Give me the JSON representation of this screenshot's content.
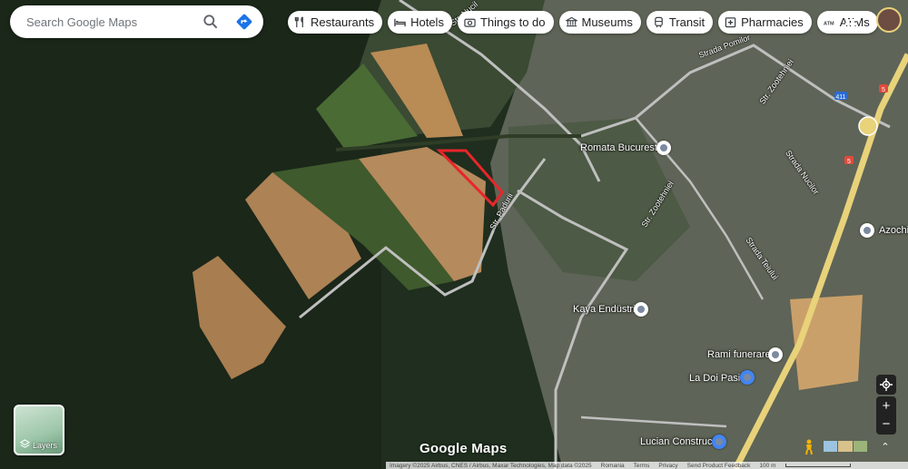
{
  "search": {
    "placeholder": "Search Google Maps"
  },
  "chips": [
    {
      "label": "Restaurants",
      "icon": "fork-knife-icon"
    },
    {
      "label": "Hotels",
      "icon": "bed-icon"
    },
    {
      "label": "Things to do",
      "icon": "camera-icon"
    },
    {
      "label": "Museums",
      "icon": "museum-icon"
    },
    {
      "label": "Transit",
      "icon": "train-icon"
    },
    {
      "label": "Pharmacies",
      "icon": "pharmacy-icon"
    },
    {
      "label": "ATMs",
      "icon": "atm-icon"
    }
  ],
  "places": [
    {
      "name": "Romata Bucuresti"
    },
    {
      "name": "Kaya Endüstri"
    },
    {
      "name": "Rami funerare"
    },
    {
      "name": "La Doi Pasi"
    },
    {
      "name": "Lucian Construct"
    },
    {
      "name": "Azochi"
    }
  ],
  "streets": [
    "Str. Nucil",
    "Strada Pomilor",
    "Str. Zootehniei",
    "Strada Nucilor",
    "Str. Zootehniei",
    "Strada Teiului",
    "Str. Padurii"
  ],
  "route_shields": [
    "411",
    "5",
    "5"
  ],
  "layers": {
    "label": "Layers"
  },
  "logo": "Google Maps",
  "footer": {
    "imagery": "Imagery ©2025 Airbus, CNES / Airbus, Maxar Technologies, Map data ©2025",
    "country": "Romania",
    "terms": "Terms",
    "privacy": "Privacy",
    "feedback": "Send Product Feedback",
    "scale": "100 m"
  },
  "controls": {
    "zoom_in": "+",
    "zoom_out": "−"
  },
  "colors": {
    "outline": "#e8262a",
    "road": "#bfbfbf",
    "highway": "#e8d27a",
    "forest": "#1f2e1e"
  }
}
